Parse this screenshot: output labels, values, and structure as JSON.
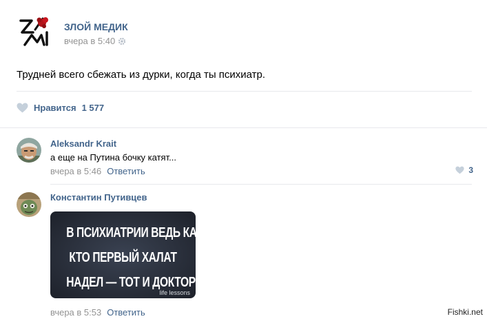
{
  "post": {
    "group_name": "ЗЛОЙ МЕДИК",
    "date": "вчера в 5:40",
    "text": "Трудней всего сбежать из дурки, когда ты психиатр.",
    "likes_label": "Нравится",
    "likes_count": "1 577"
  },
  "comments": [
    {
      "author": "Aleksandr Krait",
      "text": "а еще на Путина бочку катят...",
      "date": "вчера в 5:46",
      "reply": "Ответить",
      "likes": "3"
    },
    {
      "author": "Константин Путивцев",
      "meme_lines": [
        "В ПСИХИАТРИИ ВЕДЬ КАК:",
        "КТО ПЕРВЫЙ ХАЛАТ",
        "НАДЕЛ — ТОТ И ДОКТОР!"
      ],
      "meme_tag": "life lessons",
      "date": "вчера в 5:53",
      "reply": "Ответить"
    }
  ],
  "watermark": "Fishki.net",
  "colors": {
    "link": "#42648b",
    "muted": "#939393",
    "separator": "#e7e8ec",
    "heart": "#c5d0db"
  }
}
